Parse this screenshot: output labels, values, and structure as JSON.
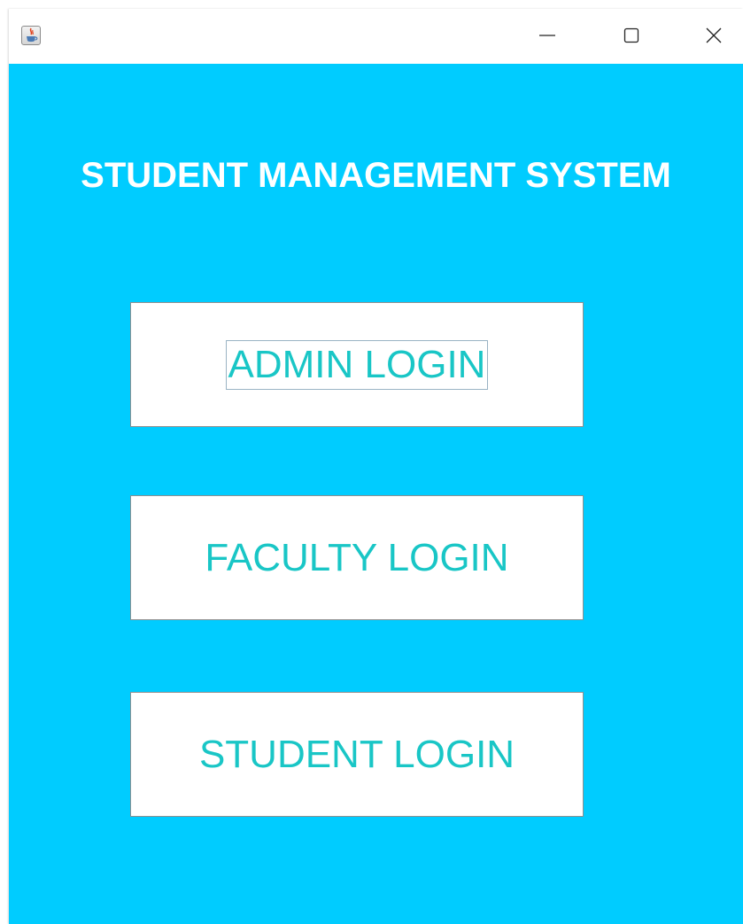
{
  "window": {
    "app_icon": "java-icon",
    "controls": {
      "minimize_icon": "minimize-icon",
      "maximize_icon": "maximize-icon",
      "close_icon": "close-icon"
    }
  },
  "main": {
    "title": "STUDENT MANAGEMENT SYSTEM",
    "buttons": [
      {
        "label": "ADMIN LOGIN",
        "focused": true
      },
      {
        "label": "FACULTY LOGIN",
        "focused": false
      },
      {
        "label": "STUDENT LOGIN",
        "focused": false
      }
    ]
  },
  "colors": {
    "background": "#00ccff",
    "title_text": "#ffffff",
    "button_text": "#19c6c6",
    "button_background": "#ffffff"
  }
}
